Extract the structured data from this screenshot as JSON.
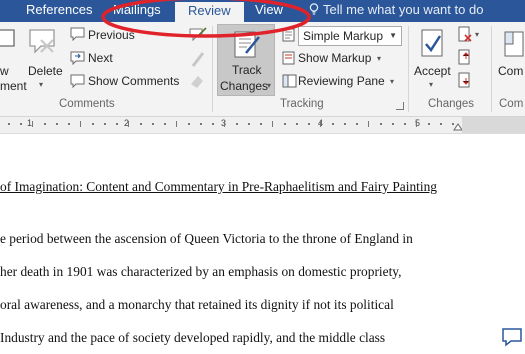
{
  "tabs": {
    "references": "References",
    "mailings": "Mailings",
    "review": "Review",
    "view": "View"
  },
  "tell_me": "Tell me what you want to do",
  "ribbon": {
    "comments": {
      "new_comment_fragment": "ment",
      "new_comment_fragment_top": "w",
      "delete": "Delete",
      "previous": "Previous",
      "next": "Next",
      "show_comments": "Show Comments",
      "group_label": "Comments"
    },
    "tracking": {
      "track_changes_line1": "Track",
      "track_changes_line2": "Changes",
      "markup_select": "Simple Markup",
      "show_markup": "Show Markup",
      "reviewing_pane": "Reviewing Pane",
      "group_label": "Tracking"
    },
    "changes": {
      "accept": "Accept",
      "group_label": "Changes"
    },
    "compare": {
      "label": "Com",
      "group_label": "Com"
    }
  },
  "ruler": {
    "numbers": [
      "1",
      "2",
      "3",
      "4",
      "5"
    ]
  },
  "document": {
    "title": "of Imagination: Content and Commentary in Pre-Raphaelitism and Fairy Painting",
    "lines": [
      "e period between the ascension of Queen Victoria to the throne of England in",
      "her death in 1901 was characterized by an emphasis on domestic propriety,",
      "oral awareness, and a monarchy that retained its dignity if not its political",
      " Industry and the pace of society developed rapidly, and the middle class"
    ]
  },
  "colors": {
    "tab_bar": "#2b579a",
    "ribbon": "#f3f3f3",
    "annotation": "#e0232b"
  }
}
